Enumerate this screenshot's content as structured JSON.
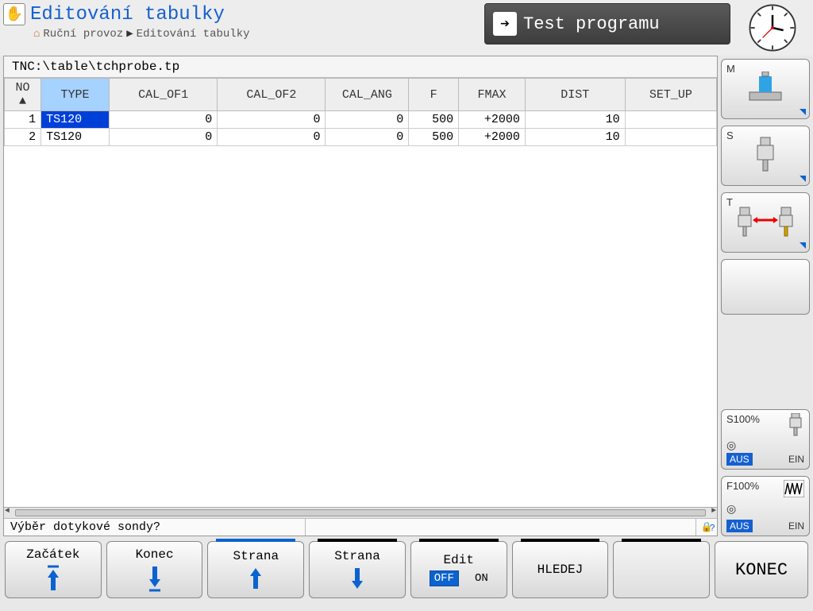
{
  "header": {
    "mode_title": "Editování tabulky",
    "breadcrumb_root": "Ruční provoz",
    "breadcrumb_current": "Editování tabulky",
    "test_tab_label": "Test programu"
  },
  "file_path": "TNC:\\table\\tchprobe.tp",
  "table": {
    "columns": [
      "NO ▲",
      "TYPE",
      "CAL_OF1",
      "CAL_OF2",
      "CAL_ANG",
      "F",
      "FMAX",
      "DIST",
      "SET_UP"
    ],
    "sorted_column_index": 1,
    "rows": [
      {
        "no": "1",
        "type": "TS120",
        "cal_of1": "0",
        "cal_of2": "0",
        "cal_ang": "0",
        "f": "500",
        "fmax": "+2000",
        "dist": "10",
        "set_up": ""
      },
      {
        "no": "2",
        "type": "TS120",
        "cal_of1": "0",
        "cal_of2": "0",
        "cal_ang": "0",
        "f": "500",
        "fmax": "+2000",
        "dist": "10",
        "set_up": ""
      }
    ],
    "selected": {
      "row": 0,
      "col": "type"
    }
  },
  "prompt": "Výběr dotykové sondy?",
  "side": {
    "m_label": "M",
    "s_label": "S",
    "t_label": "T",
    "s_override": "S100%",
    "f_override": "F100%",
    "aus": "AUS",
    "ein": "EIN"
  },
  "softkeys": {
    "k1": "Začátek",
    "k2": "Konec",
    "k3": "Strana",
    "k4": "Strana",
    "k5": "Edit",
    "k5_off": "OFF",
    "k5_on": "ON",
    "k6": "HLEDEJ",
    "k8": "KONEC"
  }
}
